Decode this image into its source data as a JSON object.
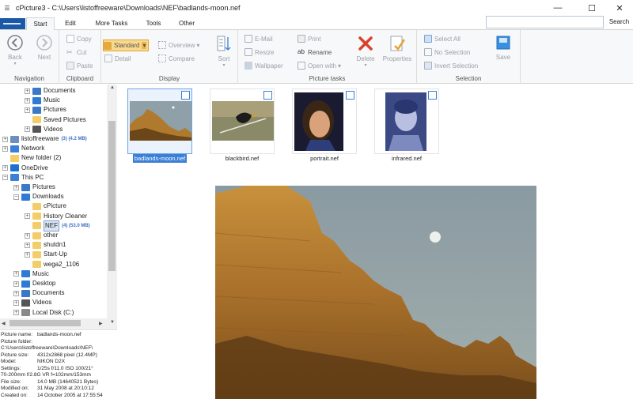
{
  "window": {
    "title": "cPicture3 - C:\\Users\\listoffreeware\\Downloads\\NEF\\badlands-moon.nef",
    "quick_access": "☰",
    "minimize": "—",
    "maximize": "☐",
    "close": "✕"
  },
  "tabs": {
    "start": "Start",
    "edit": "Edit",
    "more_tasks": "More Tasks",
    "tools": "Tools",
    "other": "Other",
    "search_button": "Search",
    "search_placeholder": ""
  },
  "ribbon": {
    "navigation": {
      "label": "Navigation",
      "back": "Back",
      "next": "Next"
    },
    "clipboard": {
      "label": "Clipboard",
      "copy": "Copy",
      "cut": "Cut",
      "paste": "Paste"
    },
    "display": {
      "label": "Display",
      "standard": "Standard",
      "detail": "Detail",
      "overview": "Overview",
      "compare": "Compare",
      "sort": "Sort"
    },
    "picture_tasks": {
      "label": "Picture tasks",
      "email": "E-Mail",
      "resize": "Resize",
      "wallpaper": "Wallpaper",
      "print": "Print",
      "rename": "Rename",
      "open_with": "Open with",
      "delete": "Delete",
      "properties": "Properties"
    },
    "selection": {
      "label": "Selection",
      "select_all": "Select All",
      "no_selection": "No Selection",
      "invert": "Invert Selection",
      "save": "Save"
    }
  },
  "tree": {
    "items": [
      {
        "label": "Documents",
        "count": "",
        "icon": "documents-icon",
        "color": "#3a78c8"
      },
      {
        "label": "Music",
        "count": "",
        "icon": "music-icon",
        "color": "#2f7ad4"
      },
      {
        "label": "Pictures",
        "count": "",
        "icon": "pictures-icon",
        "color": "#3a78c8"
      },
      {
        "label": "Saved Pictures",
        "count": "",
        "icon": "folder-icon",
        "color": "#f3cd6a"
      },
      {
        "label": "Videos",
        "count": "",
        "icon": "videos-icon",
        "color": "#555555"
      },
      {
        "label": "listoffreeware",
        "count": "(3) (4.2 MB)",
        "icon": "user-icon",
        "color": "#6a8fc0"
      },
      {
        "label": "Network",
        "count": "",
        "icon": "network-icon",
        "color": "#3b7fd6"
      },
      {
        "label": "New folder (2)",
        "count": "",
        "icon": "folder-icon",
        "color": "#f3cd6a"
      },
      {
        "label": "OneDrive",
        "count": "",
        "icon": "cloud-icon",
        "color": "#1f6fd0"
      },
      {
        "label": "This PC",
        "count": "",
        "icon": "computer-icon",
        "color": "#3b7fd6"
      },
      {
        "label": "Pictures",
        "count": "",
        "icon": "pictures-icon",
        "color": "#3a78c8"
      },
      {
        "label": "Downloads",
        "count": "",
        "icon": "downloads-icon",
        "color": "#2f7ad4"
      },
      {
        "label": "cPicture",
        "count": "",
        "icon": "folder-icon",
        "color": "#f3cd6a"
      },
      {
        "label": "History Cleaner",
        "count": "",
        "icon": "folder-icon",
        "color": "#f3cd6a"
      },
      {
        "label": "NEF",
        "count": "(4) (53.0 MB)",
        "icon": "folder-icon",
        "color": "#f3cd6a"
      },
      {
        "label": "other",
        "count": "",
        "icon": "folder-icon",
        "color": "#f3cd6a"
      },
      {
        "label": "shutdn1",
        "count": "",
        "icon": "folder-icon",
        "color": "#f3cd6a"
      },
      {
        "label": "Start-Up",
        "count": "",
        "icon": "folder-icon",
        "color": "#f3cd6a"
      },
      {
        "label": "wega2_1106",
        "count": "",
        "icon": "folder-icon",
        "color": "#f3cd6a"
      },
      {
        "label": "Music",
        "count": "",
        "icon": "music-icon",
        "color": "#2f7ad4"
      },
      {
        "label": "Desktop",
        "count": "",
        "icon": "desktop-icon",
        "color": "#2f7ad4"
      },
      {
        "label": "Documents",
        "count": "",
        "icon": "documents-icon",
        "color": "#3a78c8"
      },
      {
        "label": "Videos",
        "count": "",
        "icon": "videos-icon",
        "color": "#555555"
      },
      {
        "label": "Local Disk (C:)",
        "count": "",
        "icon": "disk-icon",
        "color": "#8a8a8a"
      }
    ]
  },
  "info": [
    {
      "key": "Picture name:",
      "value": "badlands-moon.nef"
    },
    {
      "key": "Picture folder:",
      "value": ""
    },
    {
      "key": "C:\\Users\\listoffreeware\\Downloads\\NEF\\",
      "value": ""
    },
    {
      "key": "Picture size:",
      "value": "4312x2868 pixel (12.4MP)"
    },
    {
      "key": "Model:",
      "value": "NIKON D2X"
    },
    {
      "key": "Settings:",
      "value": "1/25s f/11.0 ISO 100/21°"
    },
    {
      "key": "70-200mm f/2.8G VR f=102mm/153mm",
      "value": ""
    },
    {
      "key": "File size:",
      "value": "14.0 MB (14640521 Bytes)"
    },
    {
      "key": "Modified on:",
      "value": "31 May 2008 at 20:10:12"
    },
    {
      "key": "Created on:",
      "value": "14 October 2005 at 17:55:54"
    }
  ],
  "thumbnails": [
    {
      "name": "badlands-moon.nef"
    },
    {
      "name": "blackbird.nef"
    },
    {
      "name": "portrait.nef"
    },
    {
      "name": "infrared.nef"
    }
  ]
}
